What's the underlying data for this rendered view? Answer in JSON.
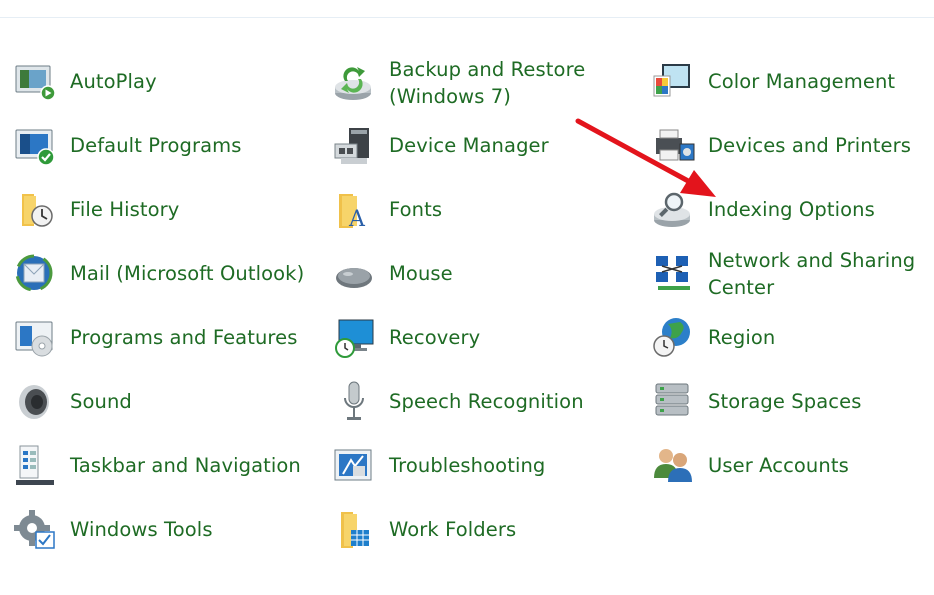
{
  "items": [
    {
      "label": "AutoPlay",
      "icon": "autoplay-icon"
    },
    {
      "label": "Default Programs",
      "icon": "default-programs-icon"
    },
    {
      "label": "File History",
      "icon": "file-history-icon"
    },
    {
      "label": "Mail (Microsoft Outlook)",
      "icon": "mail-icon"
    },
    {
      "label": "Programs and Features",
      "icon": "programs-features-icon"
    },
    {
      "label": "Sound",
      "icon": "speaker-icon"
    },
    {
      "label": "Taskbar and Navigation",
      "icon": "taskbar-icon"
    },
    {
      "label": "Windows Tools",
      "icon": "gear-icon"
    },
    {
      "label": "Backup and Restore",
      "label2": "(Windows 7)",
      "icon": "backup-icon"
    },
    {
      "label": "Device Manager",
      "icon": "device-manager-icon"
    },
    {
      "label": "Fonts",
      "icon": "fonts-icon"
    },
    {
      "label": "Mouse",
      "icon": "mouse-icon"
    },
    {
      "label": "Recovery",
      "icon": "recovery-icon"
    },
    {
      "label": "Speech Recognition",
      "icon": "microphone-icon"
    },
    {
      "label": "Troubleshooting",
      "icon": "troubleshooting-icon"
    },
    {
      "label": "Work Folders",
      "icon": "work-folders-icon"
    },
    {
      "label": "Color Management",
      "icon": "color-management-icon"
    },
    {
      "label": "Devices and Printers",
      "icon": "printer-icon"
    },
    {
      "label": "Indexing Options",
      "icon": "indexing-icon"
    },
    {
      "label": "Network and Sharing",
      "label2": "Center",
      "icon": "network-icon"
    },
    {
      "label": "Region",
      "icon": "globe-clock-icon"
    },
    {
      "label": "Storage Spaces",
      "icon": "storage-icon"
    },
    {
      "label": "User Accounts",
      "icon": "users-icon"
    }
  ],
  "colors": {
    "link": "#1e6b24",
    "arrow": "#e3141c"
  }
}
